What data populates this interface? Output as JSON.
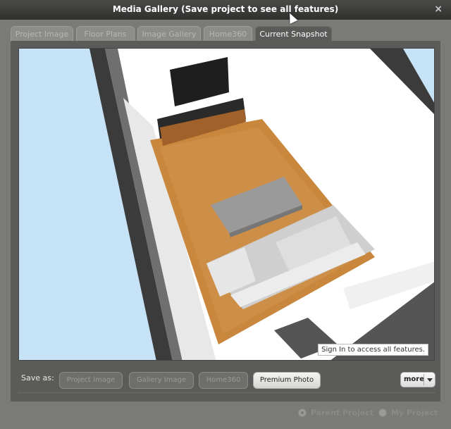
{
  "window": {
    "title": "Media Gallery (Save project to see all features)",
    "close_glyph": "×"
  },
  "tabs": [
    {
      "label": "Project Image"
    },
    {
      "label": "Floor Plans"
    },
    {
      "label": "Image Gallery"
    },
    {
      "label": "Home360"
    },
    {
      "label": "Current Snapshot"
    }
  ],
  "active_tab": "Current Snapshot",
  "viewport": {
    "notice": "Sign In to access all features."
  },
  "toolbar": {
    "save_as_label": "Save as:",
    "buttons": [
      {
        "label": "Project Image"
      },
      {
        "label": "Gallery Image"
      },
      {
        "label": "Home360"
      },
      {
        "label": "Premium Photo"
      }
    ],
    "more_label": "more"
  },
  "options": {
    "parent_project": "Parent Project",
    "my_project": "My Project",
    "selected": "Parent Project"
  },
  "colors": {
    "floor": "#c8873c",
    "sky": "#c5e2f7",
    "wall_dark": "#3b3b3b"
  }
}
